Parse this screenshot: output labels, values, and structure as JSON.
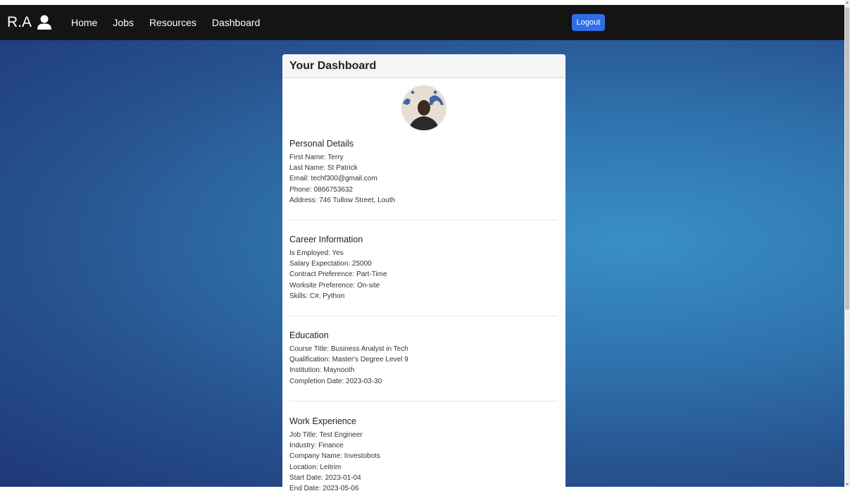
{
  "brand": {
    "text": "R.A",
    "icon": "user-icon"
  },
  "nav": {
    "links": [
      "Home",
      "Jobs",
      "Resources",
      "Dashboard"
    ],
    "logout_label": "Logout"
  },
  "card": {
    "title": "Your Dashboard",
    "avatar_icon": "profile-photo",
    "sections": [
      {
        "heading": "Personal Details",
        "lines": [
          "First Name: Terry",
          "Last Name: St Patrick",
          "Email: techf300@gmail.com",
          "Phone: 0866753632",
          "Address: 746 Tullow Street, Louth"
        ]
      },
      {
        "heading": "Career Information",
        "lines": [
          "Is Employed: Yes",
          "Salary Expectation: 25000",
          "Contract Preference: Part-Time",
          "Worksite Preference: On-site",
          "Skills: C#, Python"
        ]
      },
      {
        "heading": "Education",
        "lines": [
          "Course Title: Business Analyst in Tech",
          "Qualification: Master's Degree Level 9",
          "Institution: Maynooth",
          "Completion Date: 2023-03-30"
        ]
      },
      {
        "heading": "Work Experience",
        "lines": [
          "Job Title: Test Engineer",
          "Industry: Finance",
          "Company Name: Investobots",
          "Location: Leitrim",
          "Start Date: 2023-01-04",
          "End Date: 2023-05-06"
        ]
      }
    ]
  },
  "colors": {
    "navbar": "#141414",
    "logout_button": "#2f6ee8",
    "background_light": "#3a8fc6",
    "background_dark": "#1e3876"
  }
}
